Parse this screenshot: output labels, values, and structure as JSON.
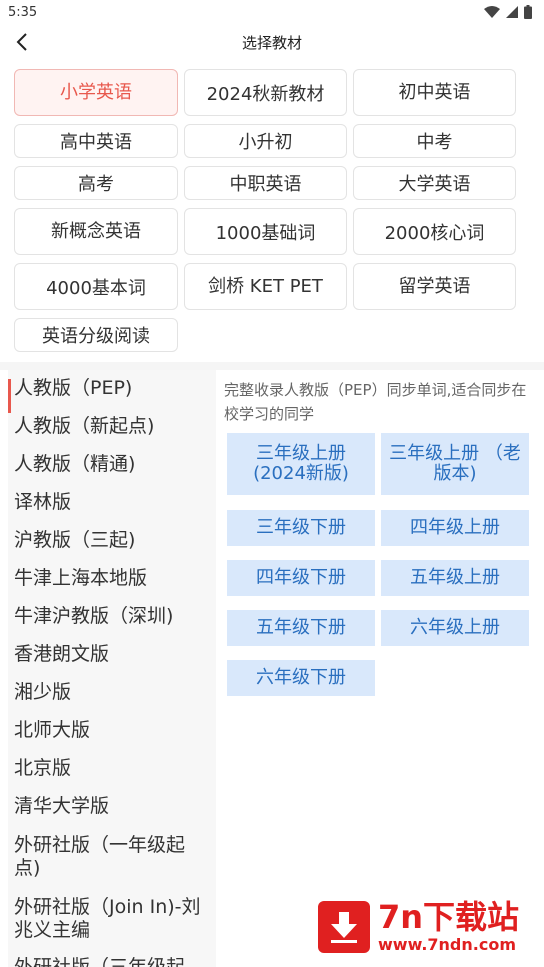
{
  "status": {
    "time": "5:35"
  },
  "header": {
    "title": "选择教材"
  },
  "categories": [
    {
      "label": "小学英语",
      "selected": true
    },
    {
      "label": "2024秋新教材"
    },
    {
      "label": "初中英语"
    },
    {
      "label": "高中英语"
    },
    {
      "label": "小升初"
    },
    {
      "label": "中考"
    },
    {
      "label": "高考"
    },
    {
      "label": "中职英语"
    },
    {
      "label": "大学英语"
    },
    {
      "label": "新概念英语"
    },
    {
      "label": "1000基础词"
    },
    {
      "label": "2000核心词"
    },
    {
      "label": "4000基本词"
    },
    {
      "label": "剑桥 KET PET"
    },
    {
      "label": "留学英语"
    },
    {
      "label": "英语分级阅读"
    }
  ],
  "editions": [
    {
      "label": "人教版（PEP)",
      "active": true
    },
    {
      "label": "人教版（新起点)"
    },
    {
      "label": "人教版（精通)"
    },
    {
      "label": "译林版"
    },
    {
      "label": "沪教版（三起)"
    },
    {
      "label": "牛津上海本地版"
    },
    {
      "label": "牛津沪教版（深圳)"
    },
    {
      "label": "香港朗文版"
    },
    {
      "label": "湘少版"
    },
    {
      "label": "北师大版"
    },
    {
      "label": "北京版"
    },
    {
      "label": "清华大学版"
    },
    {
      "label": "外研社版（一年级起点)"
    },
    {
      "label": "外研社版（Join In)-刘兆义主编"
    },
    {
      "label": "外研社版（三年级起"
    }
  ],
  "detail": {
    "description": "完整收录人教版（PEP）同步单词,适合同步在校学习的同学",
    "volumes": [
      {
        "label": "三年级上册(2024新版)"
      },
      {
        "label": "三年级上册 （老版本)"
      },
      {
        "label": "三年级下册"
      },
      {
        "label": "四年级上册"
      },
      {
        "label": "四年级下册"
      },
      {
        "label": "五年级上册"
      },
      {
        "label": "五年级下册"
      },
      {
        "label": "六年级上册"
      },
      {
        "label": "六年级下册"
      }
    ]
  },
  "watermark": {
    "title": "7n下载站",
    "url": "www.7ndn.com"
  },
  "colors": {
    "accent": "#e8584d",
    "volume_bg": "#d9e8fb",
    "volume_text": "#2a6fbf"
  }
}
